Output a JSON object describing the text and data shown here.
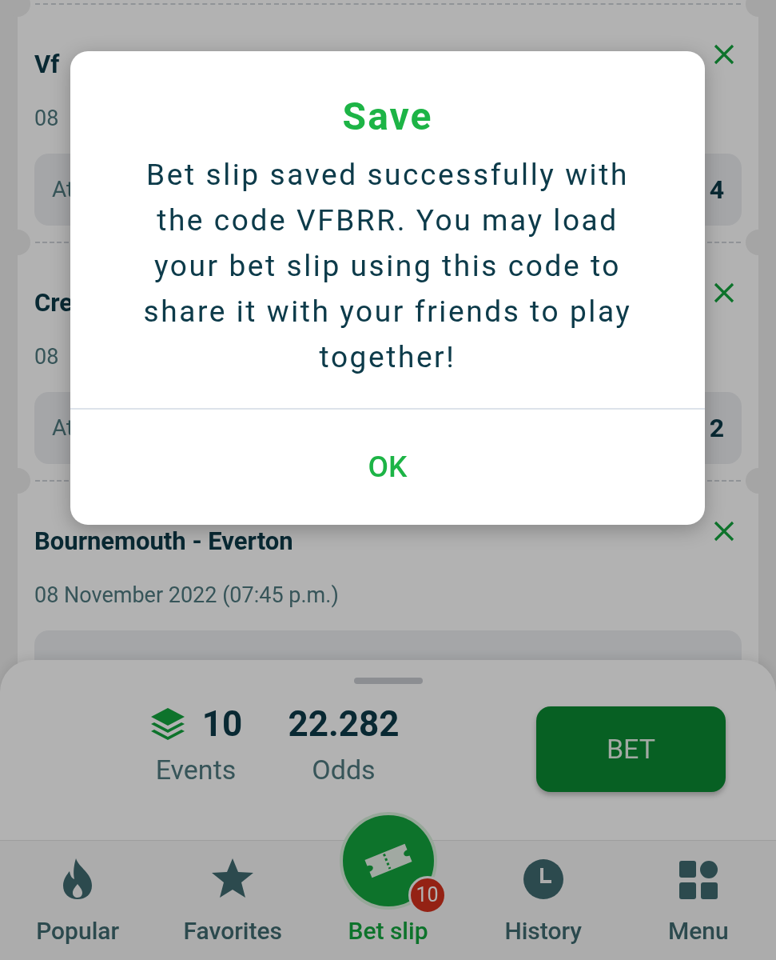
{
  "background_cards": [
    {
      "title": "Vf",
      "date": "08",
      "market": "At",
      "odds": "4"
    },
    {
      "title": "Cre",
      "date": "08",
      "market": "At",
      "odds": "2"
    },
    {
      "title": "Bournemouth - Everton",
      "date": "08 November 2022 (07:45 p.m.)"
    }
  ],
  "dialog": {
    "title": "Save",
    "message": "Bet slip saved successfully with the code VFBRR. You may load your bet slip using this code to share it with your friends to play together!",
    "button": "OK"
  },
  "summary": {
    "events_count": "10",
    "events_label": "Events",
    "odds_value": "22.282",
    "odds_label": "Odds",
    "bet_button": "BET"
  },
  "nav": [
    {
      "kind": "flame",
      "label": "Popular",
      "selected": false
    },
    {
      "kind": "star",
      "label": "Favorites",
      "selected": false
    },
    {
      "kind": "ticket",
      "label": "Bet slip",
      "selected": true,
      "badge": "10"
    },
    {
      "kind": "clock",
      "label": "History",
      "selected": false
    },
    {
      "kind": "grid",
      "label": "Menu",
      "selected": false
    }
  ]
}
